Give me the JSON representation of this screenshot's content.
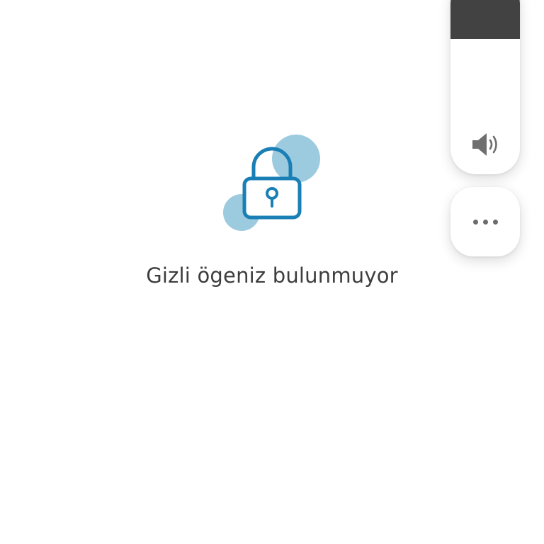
{
  "empty_state": {
    "message": "Gizli ögeniz bulunmuyor",
    "icon": "lock-icon"
  },
  "volume_panel": {
    "icon": "speaker-icon",
    "level_fraction": 0.3
  },
  "more_button": {
    "icon": "more-horizontal-icon"
  },
  "colors": {
    "lock_stroke": "#1a7fb5",
    "bubble": "#9ccbe0",
    "slider_fill": "#424242",
    "text": "#3d3d3d"
  }
}
